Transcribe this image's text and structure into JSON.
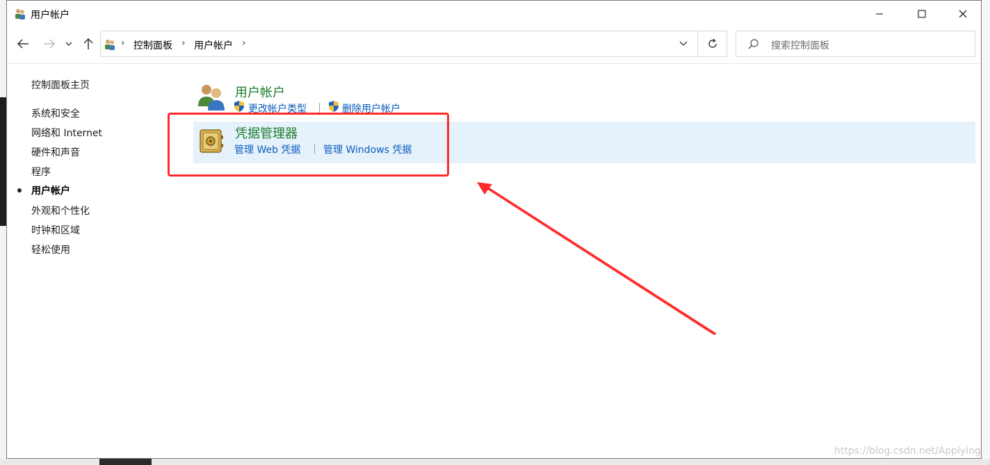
{
  "window": {
    "title": "用户帐户",
    "minimize_label": "Minimize",
    "maximize_label": "Maximize",
    "close_label": "Close"
  },
  "navigation": {
    "breadcrumb": [
      "控制面板",
      "用户帐户"
    ],
    "search_placeholder": "搜索控制面板"
  },
  "sidebar": {
    "home": "控制面板主页",
    "items": [
      {
        "label": "系统和安全",
        "selected": false
      },
      {
        "label": "网络和 Internet",
        "selected": false
      },
      {
        "label": "硬件和声音",
        "selected": false
      },
      {
        "label": "程序",
        "selected": false
      },
      {
        "label": "用户帐户",
        "selected": true
      },
      {
        "label": "外观和个性化",
        "selected": false
      },
      {
        "label": "时钟和区域",
        "selected": false
      },
      {
        "label": "轻松使用",
        "selected": false
      }
    ]
  },
  "main": {
    "categories": [
      {
        "title": "用户帐户",
        "icon": "users-icon",
        "links": [
          "更改帐户类型",
          "删除用户帐户"
        ]
      },
      {
        "title": "凭据管理器",
        "icon": "vault-icon",
        "highlighted": true,
        "links": [
          "管理 Web 凭据",
          "管理 Windows 凭据"
        ]
      }
    ]
  },
  "annotation": {
    "color": "#ff2b2b"
  },
  "watermark": "https://blog.csdn.net/Applying",
  "colors": {
    "category_title": "#1a7d2b",
    "link": "#0a5bbd",
    "highlight": "#e5f1fb"
  }
}
